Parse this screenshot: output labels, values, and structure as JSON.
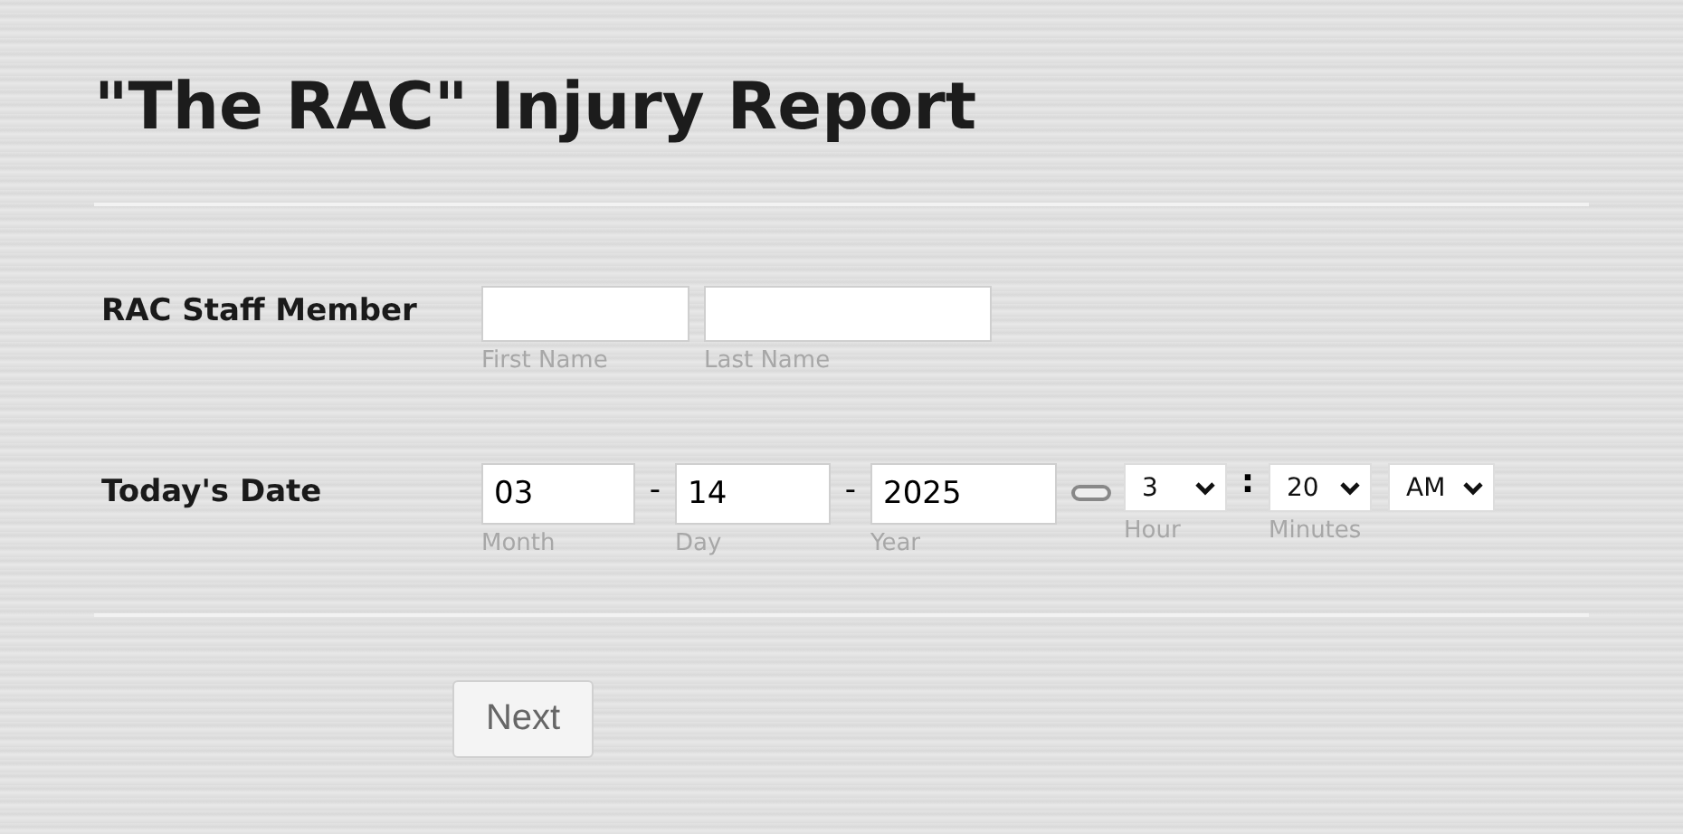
{
  "title": "\"The RAC\" Injury Report",
  "staff": {
    "label": "RAC Staff Member",
    "fields": [
      {
        "sublabel": "First Name"
      },
      {
        "sublabel": "Last Name"
      }
    ]
  },
  "date": {
    "label": "Today's Date",
    "parts": [
      {
        "value": "03",
        "sublabel": "Month"
      },
      {
        "value": "14",
        "sublabel": "Day"
      },
      {
        "value": "2025",
        "sublabel": "Year"
      }
    ],
    "separator": "-",
    "time": [
      {
        "value": "3",
        "sublabel": "Hour"
      },
      {
        "value": "20",
        "sublabel": "Minutes"
      },
      {
        "value": "AM"
      }
    ],
    "time_separator": ":"
  },
  "button": "Next"
}
